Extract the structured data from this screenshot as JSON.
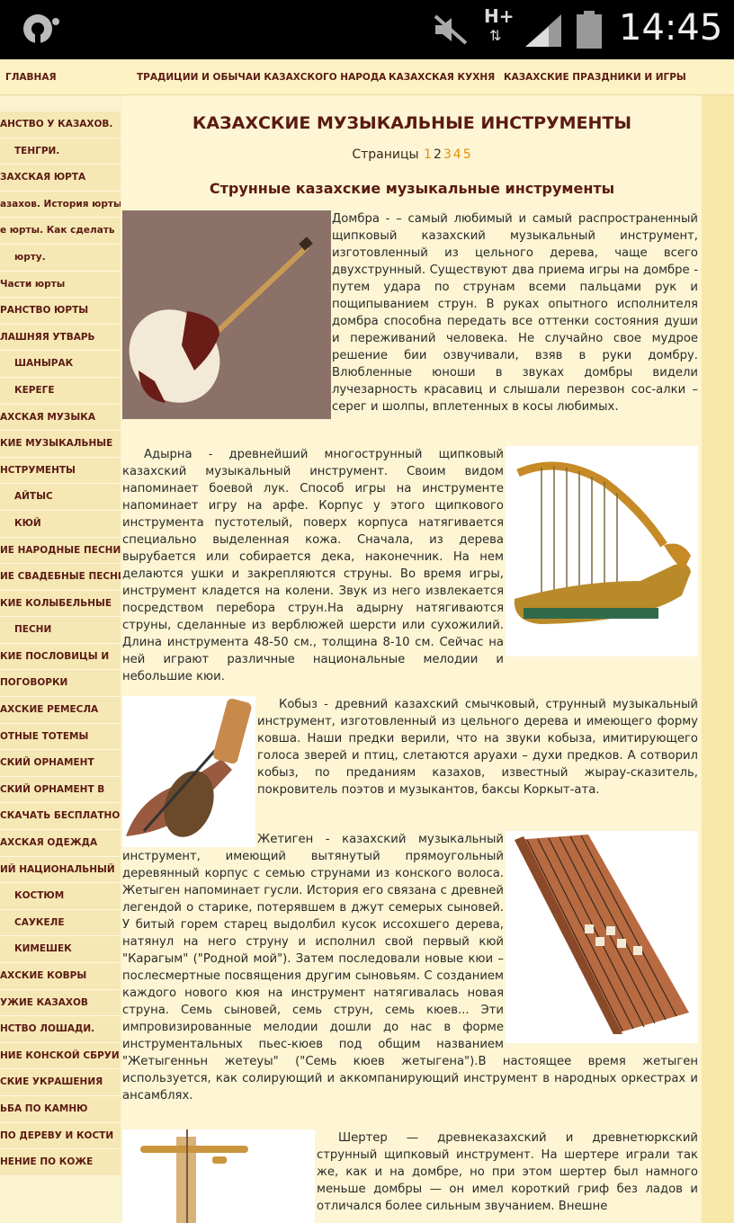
{
  "status_bar": {
    "time": "14:45",
    "network": "H+"
  },
  "top_nav": {
    "home": "ГЛАВНАЯ",
    "traditions": "ТРАДИЦИИ И ОБЫЧАИ КАЗАХСКОГО НАРОДА",
    "cuisine": "КАЗАХСКАЯ КУХНЯ",
    "holidays": "КАЗАХСКИЕ ПРАЗДНИКИ И ИГРЫ"
  },
  "sidebar": {
    "items": [
      "АНСТВО У КАЗАХОВ.",
      "ТЕНГРИ.",
      "ЗАХСКАЯ ЮРТА",
      "азахов. История юрты.",
      "е юрты. Как сделать",
      "юрту.",
      "Части юрты",
      "РАНСТВО ЮРТЫ",
      "ЛАШНЯЯ УТВАРЬ",
      "ШАНЫРАК",
      "КЕРЕГЕ",
      "АХСКАЯ МУЗЫКА",
      "КИЕ МУЗЫКАЛЬНЫЕ",
      "НСТРУМЕНТЫ",
      "АЙТЫС",
      "КЮЙ",
      "ИЕ НАРОДНЫЕ ПЕСНИ",
      "ИЕ СВАДЕБНЫЕ ПЕСНИ",
      "КИЕ КОЛЫБЕЛЬНЫЕ",
      "ПЕСНИ",
      "КИЕ ПОСЛОВИЦЫ И",
      "ПОГОВОРКИ",
      "АХСКИЕ РЕМЕСЛА",
      "ОТНЫЕ ТОТЕМЫ",
      "СКИЙ ОРНАМЕНТ",
      "СКИЙ ОРНАМЕНТ В",
      "СКАЧАТЬ БЕСПЛАТНО",
      "АХСКАЯ ОДЕЖДА",
      "ИЙ НАЦИОНАЛЬНЫЙ",
      "КОСТЮМ",
      "САУКЕЛЕ",
      "КИМЕШЕК",
      "АХСКИЕ КОВРЫ",
      "УЖИЕ КАЗАХОВ",
      "НСТВО ЛОШАДИ.",
      "НИЕ КОНСКОЙ СБРУИ",
      "СКИЕ УКРАШЕНИЯ",
      "ЬБА ПО КАМНЮ",
      "ПО ДЕРЕВУ И КОСТИ",
      "НЕНИЕ ПО КОЖЕ"
    ]
  },
  "main": {
    "title": "КАЗАХСКИЕ МУЗЫКАЛЬНЫЕ ИНСТРУМЕНТЫ",
    "pages_label": "Страницы",
    "pages": [
      "1",
      "2",
      "3",
      "4",
      "5"
    ],
    "subtitle": "Струнные казахские музыкальные инструменты",
    "paragraphs": {
      "dombra": "Домбра - – самый любимый и самый распространенный щипковый казахский музыкальный инструмент, изготовленный из цельного дерева, чаще всего двухструнный. Существуют два приема игры на домбре - путем удара по струнам всеми пальцами рук и пощипыванием струн. В руках опытного исполнителя домбра способна передать все оттенки состояния души и переживаний человека. Не случайно свое мудрое решение бии озвучивали, взяв в руки домбру. Влюбленные юноши в звуках домбры видели лучезарность красавиц и слышали перезвон сос-алки – серег и шолпы, вплетенных в косы любимых.",
      "adyrna": "Адырна - древнейший многострунный щипковый казахский музыкальный инструмент. Своим видом напоминает боевой лук. Способ игры на инструменте напоминает игру на арфе. Корпус у этого щипкового инструмента пустотелый, поверх корпуса натягивается специально выделенная кожа. Сначала, из дерева вырубается или собирается дека, наконечник. На нем делаются ушки и закрепляются струны. Во время игры, инструмент кладется на колени. Звук из него извлекается посредством перебора струн.На адырну натягиваются струны, сделанные из верблюжей шерсти или сухожилий. Длина инструмента 48-50 см., толщина 8-10 см. Сейчас на ней играют различные национальные мелодии и небольшие кюи.",
      "kobyz": "Кобыз - древний казахский смычковый, струнный музыкальный инструмент, изготовленный из цельного дерева и имеющего форму ковша. Наши предки верили, что на звуки кобыза, имитирующего голоса зверей и птиц, слетаются аруахи – духи предков. А сотворил кобыз, по преданиям казахов, известный жырау-сказитель, покровитель поэтов и музыкантов, баксы Коркыт-ата.",
      "zhetigen": "Жетиген - казахский музыкальный инструмент, имеющий вытянутый прямоугольный деревянный корпус с семью струнами из конского волоса. Жетыген напоминает гусли. История его связана с древней легендой о старике, потерявшем в джут семерых сыновей. У битый горем старец выдолбил кусок иссохшего дерева, натянул на него струну и исполнил свой первый кюй \"Карагым\" (\"Родной мой\"). Затем последовали новые кюи – послесмертные посвящения другим сыновьям. С созданием каждого нового кюя на инструмент натягивалась новая струна. Семь сыновей, семь струн, семь кюев... Эти импровизированные мелодии дошли до нас в форме инструментальных пьес-кюев под общим названием \"Жетыгенньн жетеуы\" (\"Семь кюев жетыгена\").В настоящее время жетыген используется, как солирующий и аккомпанирующий инструмент в народных оркестрах и ансамблях.",
      "sherter": "Шертер — древнеказахский и древнетюркский струнный щипковый инструмент. На шертере играли так же, как и на домбре, но при этом шертер был намного меньше домбры — он имел короткий гриф без ладов и отличался более сильным звучанием. Внешне"
    }
  },
  "colors": {
    "heading": "#5b1a14",
    "page_link": "#e0900a",
    "sidebar_bg": "#f6e8b4",
    "main_bg": "#fdf5d3"
  }
}
